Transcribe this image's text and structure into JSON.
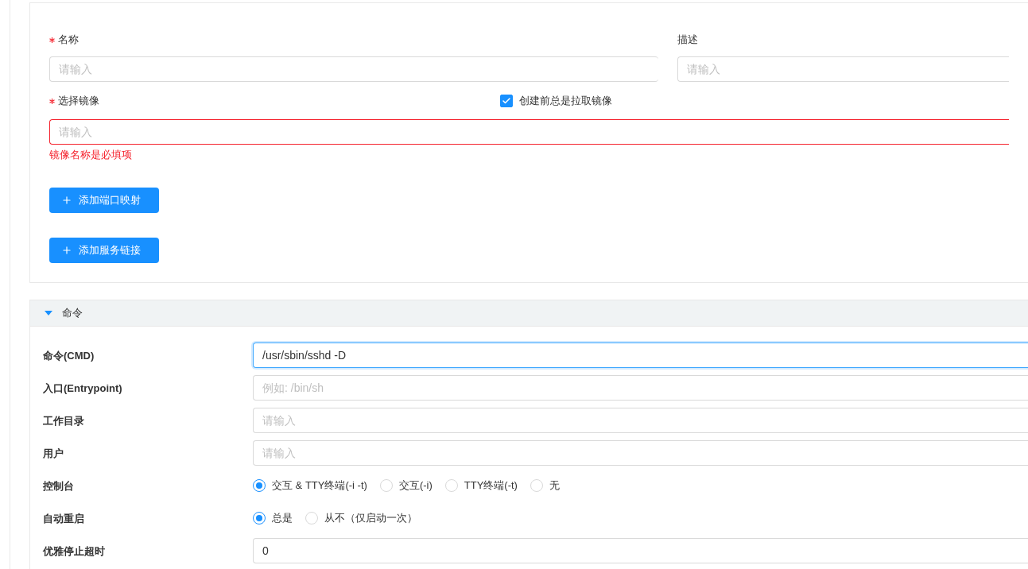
{
  "basic": {
    "fields": [
      {
        "label": "名称",
        "required": true,
        "placeholder": "请输入"
      },
      {
        "label": "描述",
        "required": false,
        "placeholder": "请输入"
      }
    ],
    "image": {
      "label": "选择镜像",
      "required": true,
      "placeholder": "请输入",
      "error": "镜像名称是必填项"
    },
    "pull_checkbox": {
      "label": "创建前总是拉取镜像",
      "checked": true
    },
    "buttons": [
      "添加端口映射",
      "添加服务链接"
    ]
  },
  "command": {
    "title": "命令",
    "expanded": true,
    "rows": [
      {
        "kind": "input",
        "label": "命令(CMD)",
        "value": "/usr/sbin/sshd -D",
        "focused": true
      },
      {
        "kind": "input",
        "label": "入口(Entrypoint)",
        "placeholder": "例如: /bin/sh",
        "focused": false
      },
      {
        "kind": "input",
        "label": "工作目录",
        "placeholder": "请输入",
        "focused": false
      },
      {
        "kind": "input",
        "label": "用户",
        "placeholder": "请输入",
        "focused": false
      },
      {
        "kind": "radio",
        "label": "控制台",
        "options": [
          {
            "label": "交互 & TTY终端(-i -t)",
            "selected": true
          },
          {
            "label": "交互(-i)",
            "selected": false
          },
          {
            "label": "TTY终端(-t)",
            "selected": false
          },
          {
            "label": "无",
            "selected": false
          }
        ]
      },
      {
        "kind": "radio",
        "label": "自动重启",
        "options": [
          {
            "label": "总是",
            "selected": true
          },
          {
            "label": "从不（仅启动一次）",
            "selected": false
          }
        ]
      },
      {
        "kind": "input",
        "label": "优雅停止超时",
        "value": "0",
        "focused": false
      }
    ]
  }
}
